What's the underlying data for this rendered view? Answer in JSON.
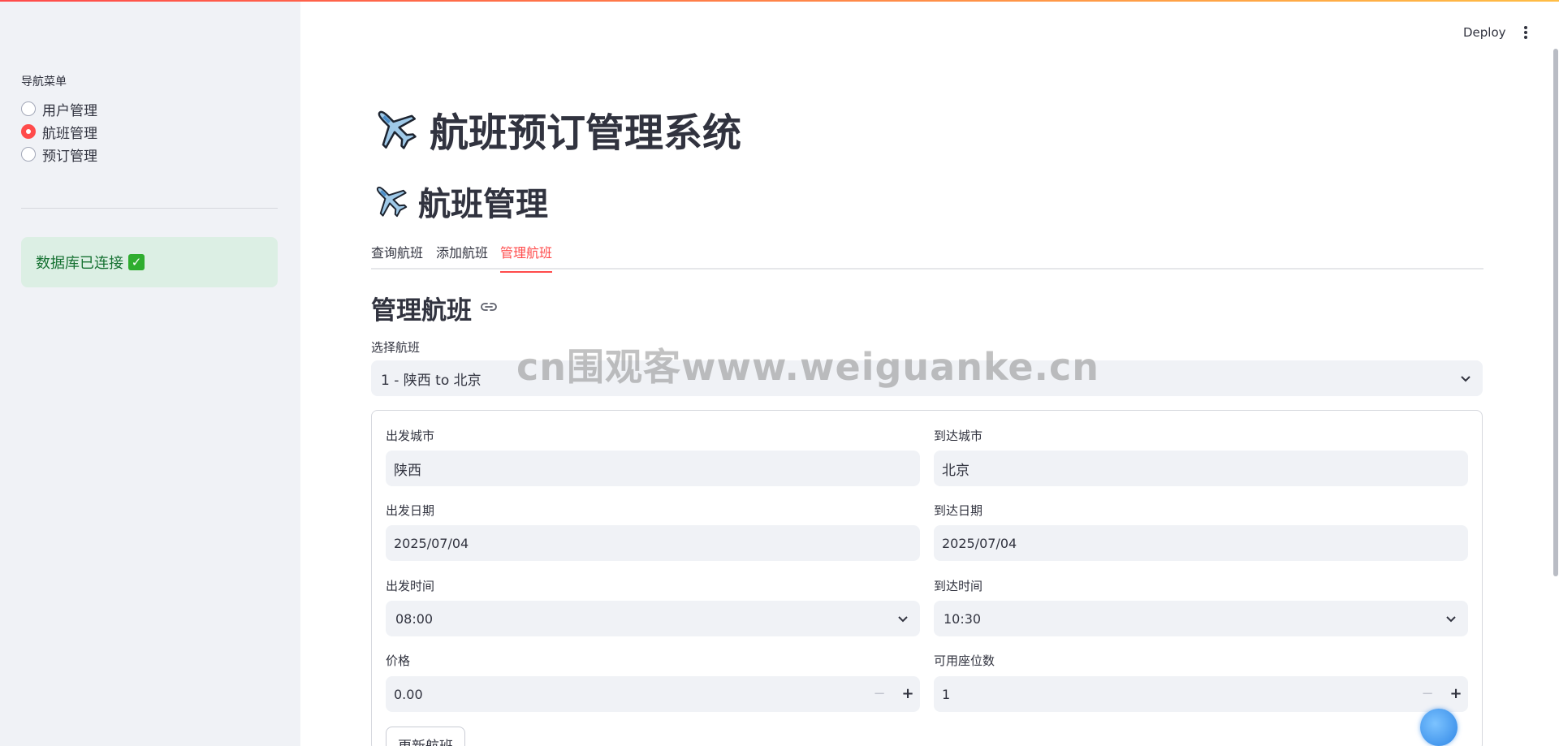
{
  "header": {
    "deploy_label": "Deploy",
    "menu_icon": "more-vertical-icon"
  },
  "sidebar": {
    "nav_label": "导航菜单",
    "items": [
      {
        "label": "用户管理",
        "checked": false
      },
      {
        "label": "航班管理",
        "checked": true
      },
      {
        "label": "预订管理",
        "checked": false
      }
    ],
    "status_text": "数据库已连接",
    "status_icon": "check-mark-icon"
  },
  "main": {
    "title": "航班预订管理系统",
    "subtitle": "航班管理",
    "tabs": [
      "查询航班",
      "添加航班",
      "管理航班"
    ],
    "active_tab": "管理航班",
    "section_title": "管理航班",
    "select_label": "选择航班",
    "select_value": "1 - 陕西 to 北京",
    "form": {
      "departure_city_label": "出发城市",
      "departure_city_value": "陕西",
      "arrival_city_label": "到达城市",
      "arrival_city_value": "北京",
      "departure_date_label": "出发日期",
      "departure_date_value": "2025/07/04",
      "arrival_date_label": "到达日期",
      "arrival_date_value": "2025/07/04",
      "departure_time_label": "出发时间",
      "departure_time_value": "08:00",
      "arrival_time_label": "到达时间",
      "arrival_time_value": "10:30",
      "price_label": "价格",
      "price_value": "0.00",
      "seats_label": "可用座位数",
      "seats_value": "1",
      "update_button": "更新航班"
    }
  },
  "watermark": "cn围观客www.weiguanke.cn",
  "colors": {
    "accent": "#ff4b4b",
    "success_bg": "#dcefe4",
    "success_text": "#177233",
    "field_bg": "#f0f2f6"
  }
}
